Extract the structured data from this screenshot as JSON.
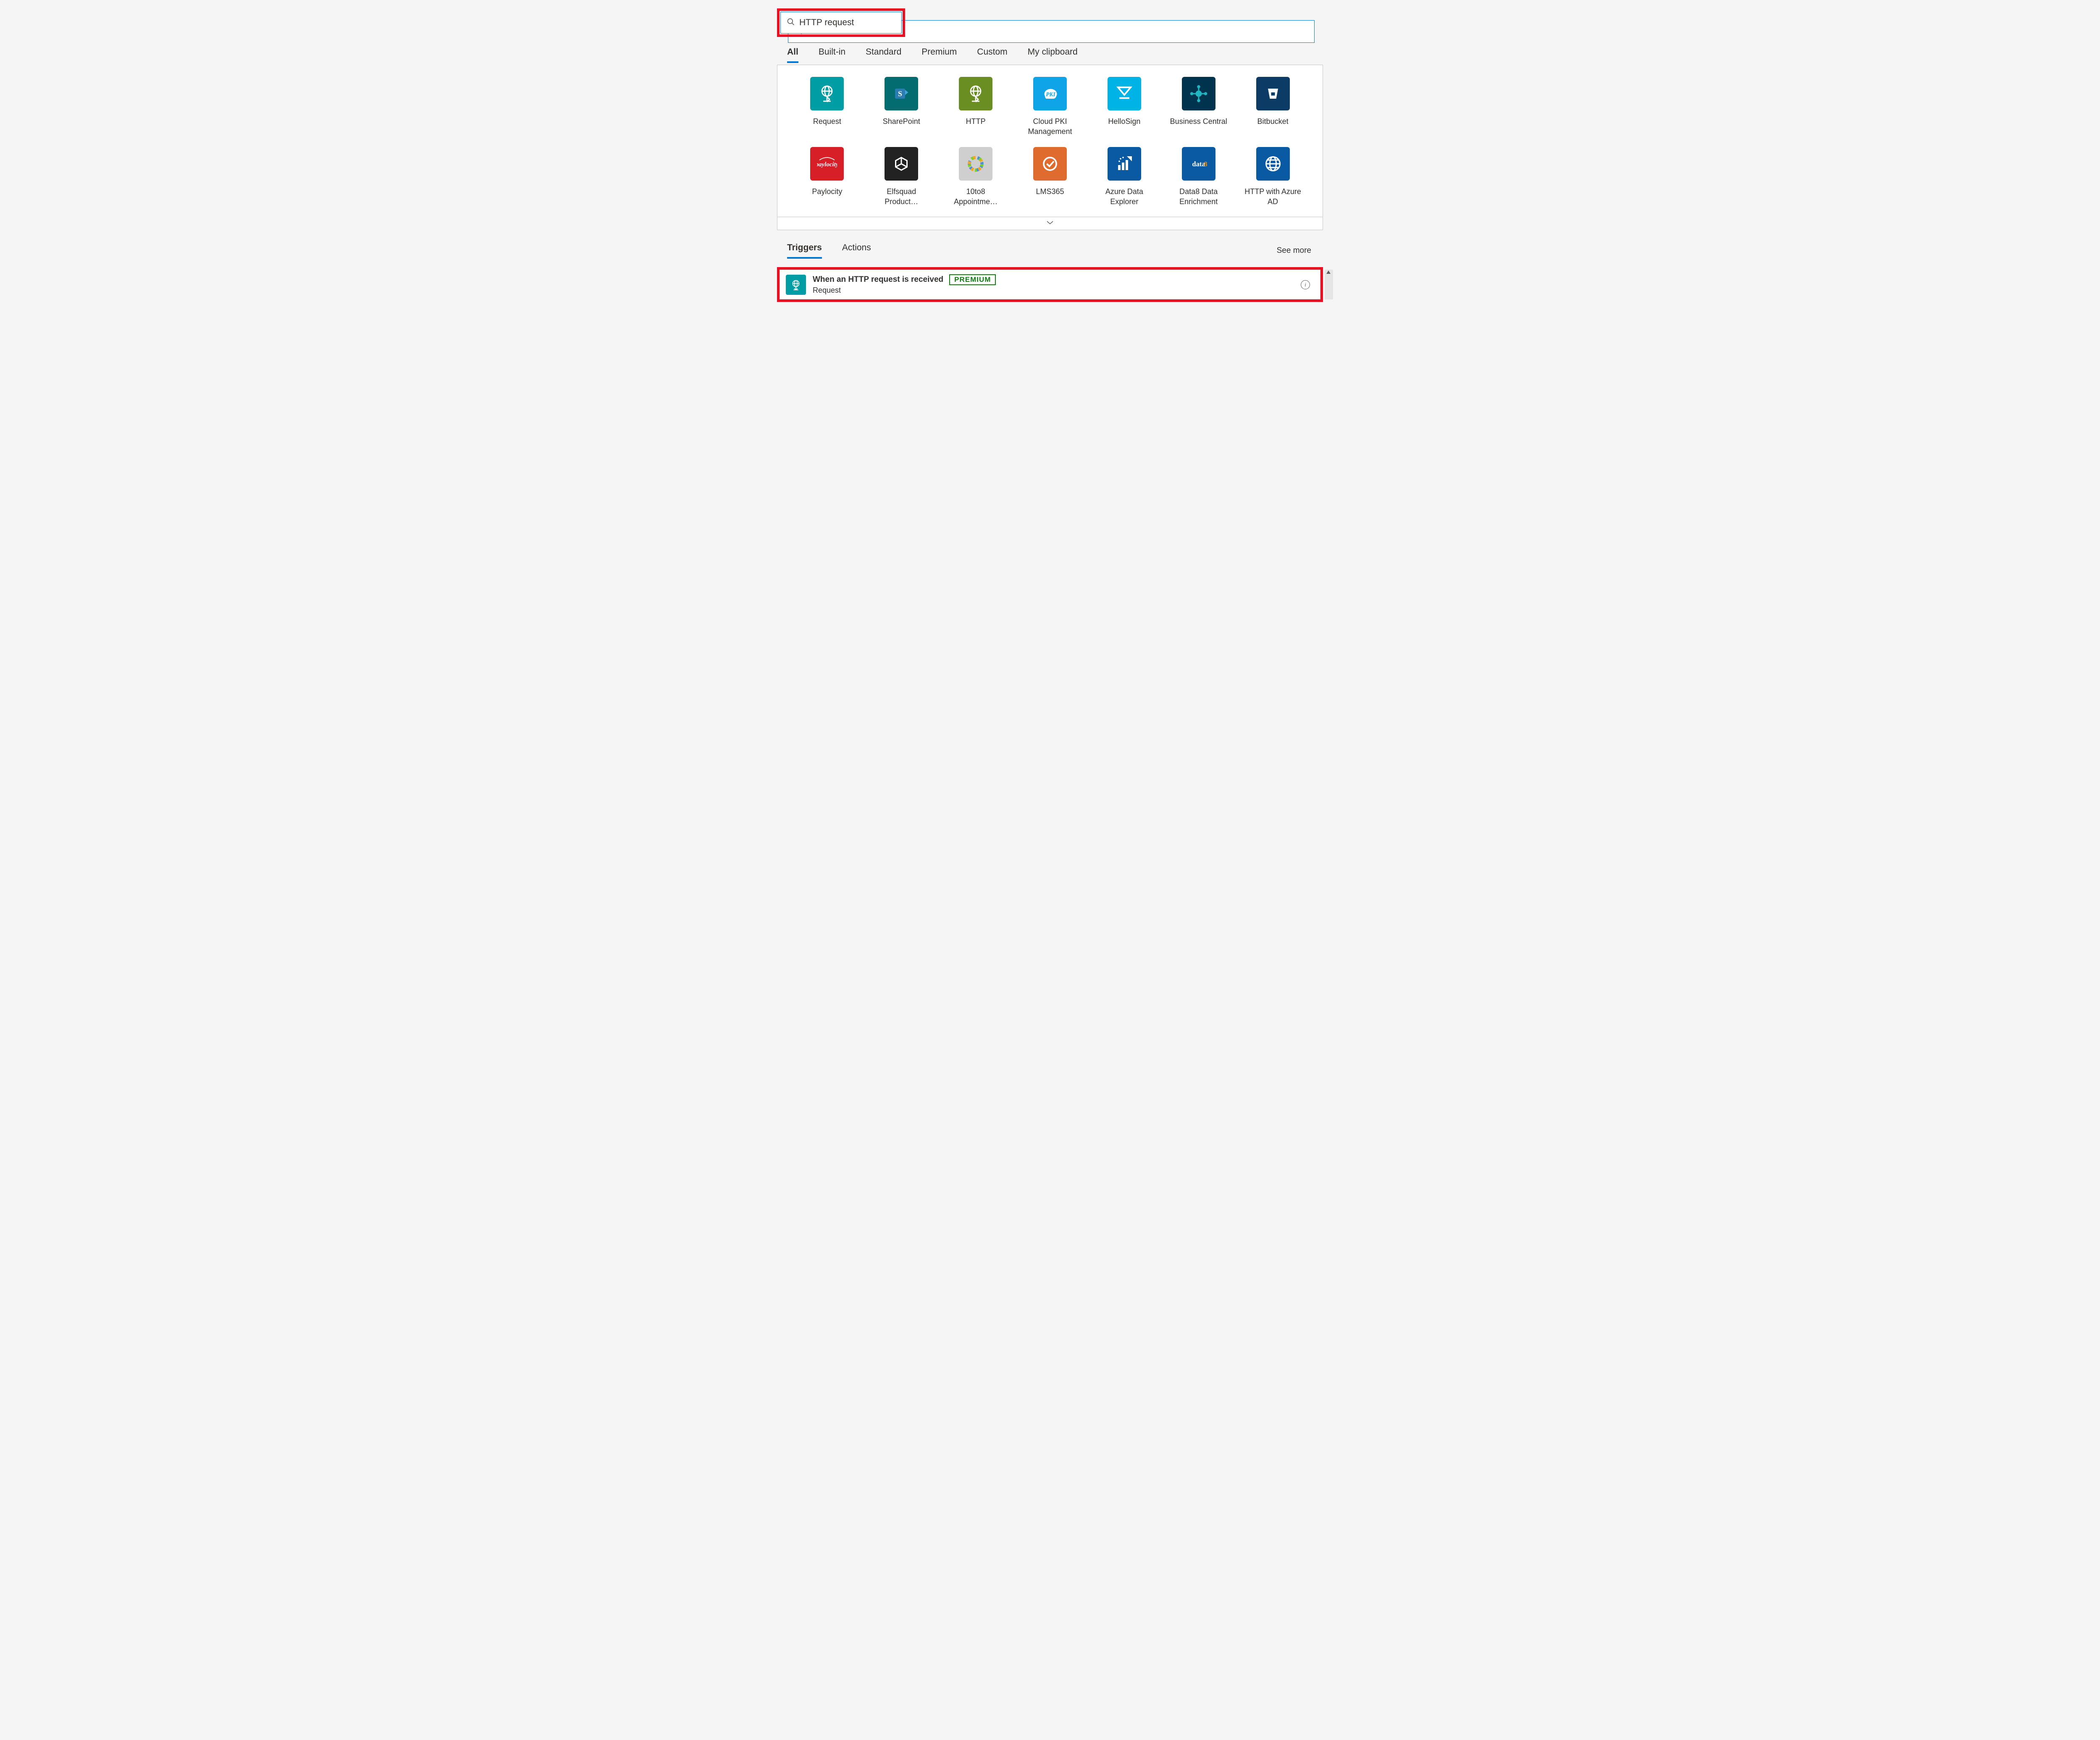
{
  "search": {
    "value": "HTTP request",
    "placeholder": "Search connectors and triggers"
  },
  "category_tabs": [
    {
      "label": "All",
      "active": true
    },
    {
      "label": "Built-in",
      "active": false
    },
    {
      "label": "Standard",
      "active": false
    },
    {
      "label": "Premium",
      "active": false
    },
    {
      "label": "Custom",
      "active": false
    },
    {
      "label": "My clipboard",
      "active": false
    }
  ],
  "connectors": [
    {
      "label": "Request",
      "bg": "#009da5",
      "icon": "globe-arrow"
    },
    {
      "label": "SharePoint",
      "bg": "#036c70",
      "icon": "sharepoint"
    },
    {
      "label": "HTTP",
      "bg": "#6b8e23",
      "icon": "globe-arrow"
    },
    {
      "label": "Cloud PKI Management",
      "bg": "#0fa3e8",
      "icon": "pki"
    },
    {
      "label": "HelloSign",
      "bg": "#00b3e6",
      "icon": "hellosign"
    },
    {
      "label": "Business Central",
      "bg": "#00334d",
      "icon": "bizcentral"
    },
    {
      "label": "Bitbucket",
      "bg": "#0c3b66",
      "icon": "bucket"
    },
    {
      "label": "Paylocity",
      "bg": "#d61f26",
      "icon": "paylocity"
    },
    {
      "label": "Elfsquad Product…",
      "bg": "#222222",
      "icon": "elfsquad"
    },
    {
      "label": "10to8 Appointme…",
      "bg": "#cfcfcf",
      "icon": "ring"
    },
    {
      "label": "LMS365",
      "bg": "#e06b2f",
      "icon": "checkcircle"
    },
    {
      "label": "Azure Data Explorer",
      "bg": "#0a5aa3",
      "icon": "ade"
    },
    {
      "label": "Data8 Data Enrichment",
      "bg": "#0a5aa3",
      "icon": "data8"
    },
    {
      "label": "HTTP with Azure AD",
      "bg": "#0a5aa3",
      "icon": "globe"
    }
  ],
  "section_tabs": [
    {
      "label": "Triggers",
      "active": true
    },
    {
      "label": "Actions",
      "active": false
    }
  ],
  "see_more": "See more",
  "trigger": {
    "title": "When an HTTP request is received",
    "badge": "PREMIUM",
    "subtitle": "Request"
  }
}
